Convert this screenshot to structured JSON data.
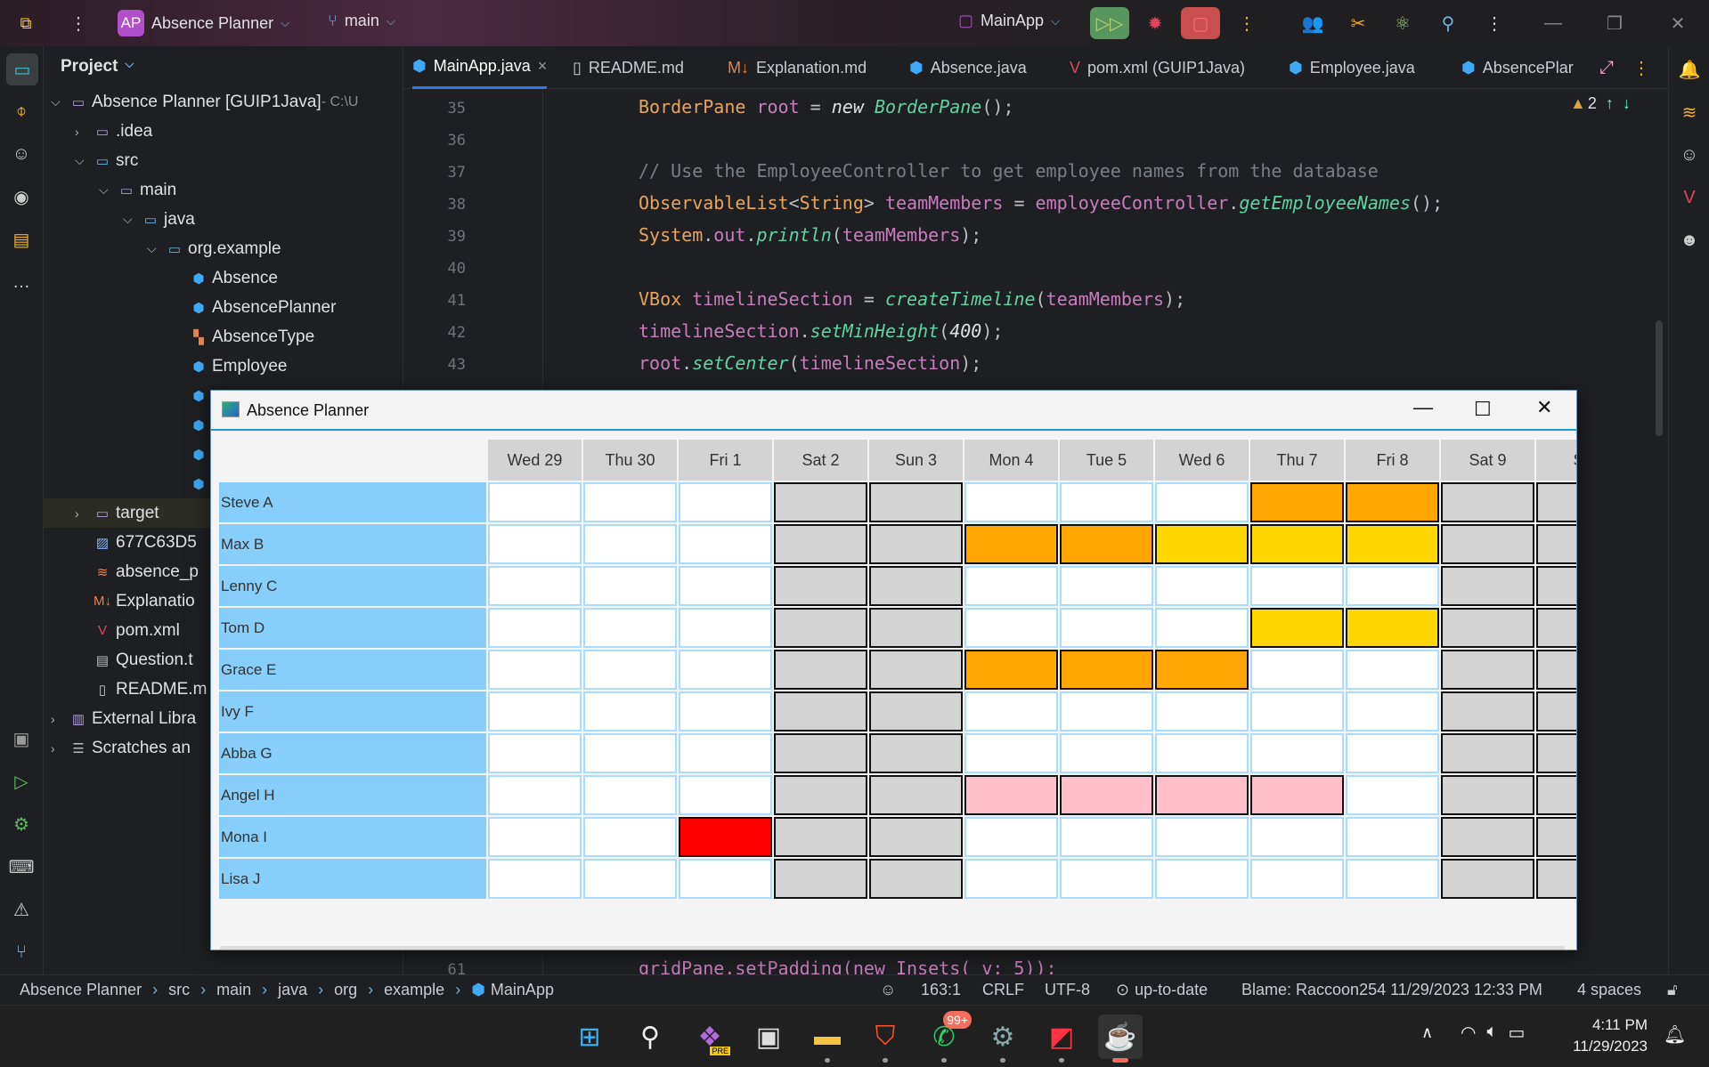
{
  "titlebar": {
    "project_badge": "AP",
    "project": "Absence Planner",
    "branch": "main",
    "run_config": "MainApp"
  },
  "project_panel": {
    "title": "Project",
    "tree": [
      {
        "label": "Absence Planner [GUIP1Java]",
        "suffix": "  - C:\\U",
        "level": 0,
        "arrow": "v",
        "icon": "folder-icon",
        "bold": true
      },
      {
        "label": ".idea",
        "level": 1,
        "arrow": ">",
        "icon": "folder-icon"
      },
      {
        "label": "src",
        "level": 1,
        "arrow": "v",
        "icon": "source-folder-icon"
      },
      {
        "label": "main",
        "level": 2,
        "arrow": "v",
        "icon": "folder-icon"
      },
      {
        "label": "java",
        "level": 3,
        "arrow": "v",
        "icon": "source-folder-icon"
      },
      {
        "label": "org.example",
        "level": 4,
        "arrow": "v",
        "icon": "package-icon"
      },
      {
        "label": "Absence",
        "level": 5,
        "icon": "class-icon"
      },
      {
        "label": "AbsencePlanner",
        "level": 5,
        "icon": "class-icon"
      },
      {
        "label": "AbsenceType",
        "level": 5,
        "icon": "enum-icon"
      },
      {
        "label": "Employee",
        "level": 5,
        "icon": "class-icon"
      },
      {
        "label": "",
        "level": 5,
        "icon": "class-icon"
      },
      {
        "label": "",
        "level": 5,
        "icon": "class-icon"
      },
      {
        "label": "",
        "level": 5,
        "icon": "class-icon"
      },
      {
        "label": "",
        "level": 5,
        "icon": "class-icon"
      },
      {
        "label": "target",
        "level": 1,
        "arrow": ">",
        "icon": "folder-icon",
        "highlight": true
      },
      {
        "label": "677C63D5",
        "level": 1,
        "icon": "image-icon"
      },
      {
        "label": "absence_p",
        "level": 1,
        "icon": "database-icon"
      },
      {
        "label": "Explanatio",
        "level": 1,
        "icon": "markdown-icon"
      },
      {
        "label": "pom.xml",
        "level": 1,
        "icon": "maven-icon"
      },
      {
        "label": "Question.t",
        "level": 1,
        "icon": "text-file-icon"
      },
      {
        "label": "README.m",
        "level": 1,
        "icon": "readme-icon"
      },
      {
        "label": "External Libra",
        "level": 0,
        "arrow": ">",
        "icon": "library-icon"
      },
      {
        "label": "Scratches an",
        "level": 0,
        "arrow": ">",
        "icon": "scratches-icon"
      }
    ]
  },
  "tabs": [
    {
      "label": "MainApp.java",
      "icon": "class-icon",
      "active": true,
      "close": "×"
    },
    {
      "label": "README.md",
      "icon": "readme-icon"
    },
    {
      "label": "Explanation.md",
      "icon": "markdown-icon"
    },
    {
      "label": "Absence.java",
      "icon": "class-icon"
    },
    {
      "label": "pom.xml (GUIP1Java)",
      "icon": "maven-icon"
    },
    {
      "label": "Employee.java",
      "icon": "class-icon"
    },
    {
      "label": "AbsencePlar",
      "icon": "class-icon"
    }
  ],
  "editor": {
    "warnings": "2",
    "lines": [
      {
        "n": "35",
        "tokens": [
          [
            "BorderPane",
            "k-type"
          ],
          [
            " root ",
            "k-var"
          ],
          [
            "= ",
            "k-p"
          ],
          [
            "new ",
            "k-kw"
          ],
          [
            "BorderPane",
            "k-m"
          ],
          [
            "();",
            "k-p"
          ]
        ]
      },
      {
        "n": "36",
        "tokens": []
      },
      {
        "n": "37",
        "tokens": [
          [
            "// Use the EmployeeController to get employee names from the database",
            "k-c"
          ]
        ]
      },
      {
        "n": "38",
        "tokens": [
          [
            "ObservableList",
            "k-type"
          ],
          [
            "<",
            "k-p"
          ],
          [
            "String",
            "k-type"
          ],
          [
            "> ",
            "k-p"
          ],
          [
            "teamMembers",
            "k-var"
          ],
          [
            " = ",
            "k-p"
          ],
          [
            "employeeController",
            "k-var"
          ],
          [
            ".",
            "k-p"
          ],
          [
            "getEmployeeNames",
            "k-m"
          ],
          [
            "();",
            "k-p"
          ]
        ]
      },
      {
        "n": "39",
        "tokens": [
          [
            "System",
            "k-type"
          ],
          [
            ".",
            "k-p"
          ],
          [
            "out",
            "k-f"
          ],
          [
            ".",
            "k-p"
          ],
          [
            "println",
            "k-m"
          ],
          [
            "(",
            "k-p"
          ],
          [
            "teamMembers",
            "k-var"
          ],
          [
            ");",
            "k-p"
          ]
        ]
      },
      {
        "n": "40",
        "tokens": []
      },
      {
        "n": "41",
        "tokens": [
          [
            "VBox",
            "k-type"
          ],
          [
            " timelineSection",
            "k-var"
          ],
          [
            " = ",
            "k-p"
          ],
          [
            "createTimeline",
            "k-m"
          ],
          [
            "(",
            "k-p"
          ],
          [
            "teamMembers",
            "k-var"
          ],
          [
            ");",
            "k-p"
          ]
        ]
      },
      {
        "n": "42",
        "tokens": [
          [
            "timelineSection",
            "k-var"
          ],
          [
            ".",
            "k-p"
          ],
          [
            "setMinHeight",
            "k-m"
          ],
          [
            "(",
            "k-p"
          ],
          [
            "400",
            "k-num"
          ],
          [
            ");",
            "k-p"
          ]
        ]
      },
      {
        "n": "43",
        "tokens": [
          [
            "root",
            "k-var"
          ],
          [
            ".",
            "k-p"
          ],
          [
            "setCenter",
            "k-m"
          ],
          [
            "(",
            "k-p"
          ],
          [
            "timelineSection",
            "k-var"
          ],
          [
            ");",
            "k-p"
          ]
        ]
      }
    ],
    "bottom_line": {
      "n": "61",
      "text": "gridPane.setPadding(new Insets( v: 5));"
    }
  },
  "dialog": {
    "title": "Absence Planner",
    "days": [
      "Wed 29",
      "Thu 30",
      "Fri 1",
      "Sat 2",
      "Sun 3",
      "Mon 4",
      "Tue 5",
      "Wed 6",
      "Thu 7",
      "Fri 8",
      "Sat 9",
      "Su"
    ],
    "weekend_days": [
      "Sat 2",
      "Sun 3",
      "Sat 9",
      "Su"
    ],
    "colors": {
      "name_cell": "#87CEFA",
      "weekend": "#D3D3D3",
      "empty": "#FFFFFF",
      "orange": "#FFA500",
      "gold": "#FFD700",
      "pink": "#FFC0CB",
      "red": "#FF0000"
    },
    "rows": [
      {
        "name": "Steve A",
        "absences": {
          "Thu 7": "orange",
          "Fri 8": "orange"
        }
      },
      {
        "name": "Max B",
        "absences": {
          "Mon 4": "orange",
          "Tue 5": "orange",
          "Wed 6": "gold",
          "Thu 7": "gold",
          "Fri 8": "gold"
        }
      },
      {
        "name": "Lenny C",
        "absences": {}
      },
      {
        "name": "Tom D",
        "absences": {
          "Thu 7": "gold",
          "Fri 8": "gold"
        }
      },
      {
        "name": "Grace E",
        "absences": {
          "Mon 4": "orange",
          "Tue 5": "orange",
          "Wed 6": "orange"
        }
      },
      {
        "name": "Ivy F",
        "absences": {}
      },
      {
        "name": "Abba G",
        "absences": {}
      },
      {
        "name": "Angel H",
        "absences": {
          "Mon 4": "pink",
          "Tue 5": "pink",
          "Wed 6": "pink",
          "Thu 7": "pink"
        }
      },
      {
        "name": "Mona I",
        "absences": {
          "Fri 1": "red"
        }
      },
      {
        "name": "Lisa J",
        "absences": {}
      }
    ]
  },
  "statusbar": {
    "breadcrumb": [
      "Absence Planner",
      "src",
      "main",
      "java",
      "org",
      "example",
      "MainApp"
    ],
    "position": "163:1",
    "line_sep": "CRLF",
    "encoding": "UTF-8",
    "vcs": "up-to-date",
    "blame": "Blame: Raccoon254 11/29/2023 12:33 PM",
    "indent": "4 spaces"
  },
  "taskbar": {
    "whatsapp_badge": "99+",
    "copilot_badge": "PRE",
    "time": "4:11 PM",
    "date": "11/29/2023"
  }
}
